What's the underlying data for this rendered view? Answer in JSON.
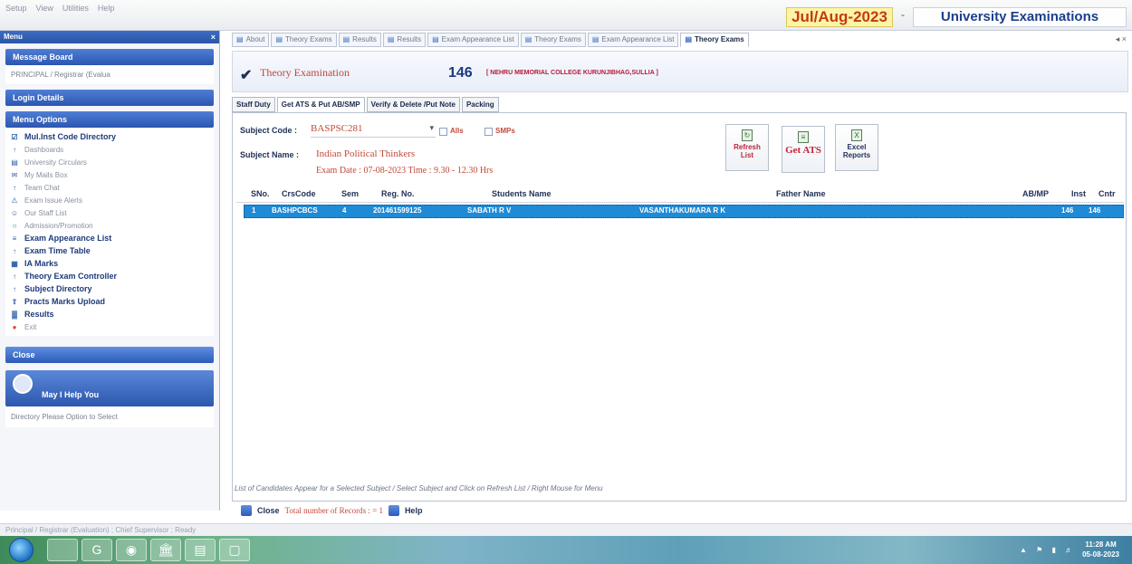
{
  "menubar": [
    "Setup",
    "View",
    "Utilities",
    "Help"
  ],
  "header": {
    "session": "Jul/Aug-2023",
    "app_title": "University Examinations"
  },
  "left_panel": {
    "title": "Menu",
    "message_board": {
      "title": "Message Board",
      "text": "PRINCIPAL / Registrar (Evalua"
    },
    "login_details": "Login Details",
    "menu_options": {
      "title": "Menu Options",
      "items": [
        {
          "label": "Mul.Inst Code Directory",
          "bold": true,
          "icon": "checkbox-icon"
        },
        {
          "label": "Dashboards",
          "bold": false,
          "icon": "pin-icon"
        },
        {
          "label": "University Circulars",
          "bold": false,
          "icon": "doc-icon"
        },
        {
          "label": "My Mails Box",
          "bold": false,
          "icon": "mail-icon"
        },
        {
          "label": "Team Chat",
          "bold": false,
          "icon": "pin-icon"
        },
        {
          "label": "Exam Issue Alerts",
          "bold": false,
          "icon": "alert-icon"
        },
        {
          "label": "Our Staff List",
          "bold": false,
          "icon": "people-icon"
        },
        {
          "label": "Admission/Promotion",
          "bold": false,
          "icon": "circle-icon"
        },
        {
          "label": "Exam Appearance List",
          "bold": true,
          "icon": "list-icon"
        },
        {
          "label": "Exam Time Table",
          "bold": true,
          "icon": "pin-icon"
        },
        {
          "label": "IA Marks",
          "bold": true,
          "icon": "grid-icon"
        },
        {
          "label": "Theory Exam Controller",
          "bold": true,
          "icon": "pin-icon"
        },
        {
          "label": "Subject Directory",
          "bold": true,
          "icon": "pin-icon"
        },
        {
          "label": "Practs Marks Upload",
          "bold": true,
          "icon": "upload-icon"
        },
        {
          "label": "Results",
          "bold": true,
          "icon": "chart-icon"
        },
        {
          "label": "Exit",
          "bold": false,
          "icon": "exit-icon"
        }
      ]
    },
    "close_label": "Close",
    "help": {
      "title": "May I Help You",
      "text": "Directory Please Option to Select"
    }
  },
  "doc_tabs": [
    {
      "label": "About",
      "active": false
    },
    {
      "label": "Theory Exams",
      "active": false
    },
    {
      "label": "Results",
      "active": false
    },
    {
      "label": "Results",
      "active": false
    },
    {
      "label": "Exam Appearance List",
      "active": false
    },
    {
      "label": "Theory Exams",
      "active": false
    },
    {
      "label": "Exam Appearance List",
      "active": false
    },
    {
      "label": "Theory Exams",
      "active": true
    }
  ],
  "form": {
    "title": "Theory Examination",
    "inst_code": "146",
    "inst_name": "[ NEHRU MEMORIAL COLLEGE KURUNJIBHAG,SULLIA ]"
  },
  "sub_tabs": [
    {
      "label": "Staff Duty",
      "active": false
    },
    {
      "label": "Get ATS & Put AB/SMP",
      "active": true
    },
    {
      "label": "Verify & Delete /Put Note",
      "active": false
    },
    {
      "label": "Packing",
      "active": false
    }
  ],
  "criteria": {
    "subject_code_label": "Subject Code :",
    "subject_code": "BASPSC281",
    "alls_label": "Alls",
    "smps_label": "SMPs",
    "subject_name_label": "Subject Name :",
    "subject_name": "Indian Political Thinkers",
    "exam_date": "Exam Date : 07-08-2023   Time : 9.30 - 12.30 Hrs"
  },
  "buttons": {
    "refresh": "Refresh List",
    "get_ats": "Get ATS",
    "excel": "Excel Reports"
  },
  "grid": {
    "columns": [
      "SNo.",
      "CrsCode",
      "Sem",
      "Reg. No.",
      "Students Name",
      "Father Name",
      "AB/MP",
      "Inst",
      "Cntr"
    ],
    "rows": [
      [
        "1",
        "BASHPCBCS",
        "4",
        "201461599125",
        "SABATH R V",
        "VASANTHAKUMARA R K",
        "",
        "146",
        "146"
      ]
    ]
  },
  "hint": "List of Candidates Appear for a Selected Subject / Select Subject and Click on Refresh List / Right Mouse for Menu",
  "footer": {
    "close": "Close",
    "total_records": "Total number of Records :  = 1",
    "help": "Help"
  },
  "statusbar": "Principal / Registrar (Evaluation) ; Chief Supervisor ; Ready",
  "taskbar": {
    "time": "11:28 AM",
    "date": "05-08-2023"
  }
}
